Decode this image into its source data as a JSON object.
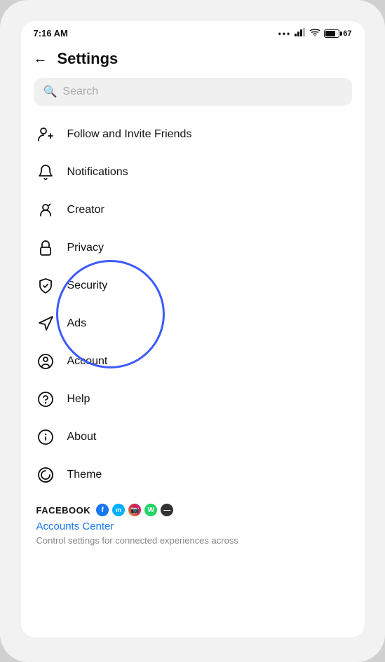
{
  "statusBar": {
    "time": "7:16 AM",
    "batteryLevel": "67"
  },
  "header": {
    "backLabel": "←",
    "title": "Settings"
  },
  "search": {
    "placeholder": "Search"
  },
  "menuItems": [
    {
      "id": "follow-invite",
      "label": "Follow and Invite Friends",
      "icon": "follow"
    },
    {
      "id": "notifications",
      "label": "Notifications",
      "icon": "bell"
    },
    {
      "id": "creator",
      "label": "Creator",
      "icon": "creator"
    },
    {
      "id": "privacy",
      "label": "Privacy",
      "icon": "lock"
    },
    {
      "id": "security",
      "label": "Security",
      "icon": "shield"
    },
    {
      "id": "ads",
      "label": "Ads",
      "icon": "ads"
    },
    {
      "id": "account",
      "label": "Account",
      "icon": "account"
    },
    {
      "id": "help",
      "label": "Help",
      "icon": "help"
    },
    {
      "id": "about",
      "label": "About",
      "icon": "info"
    },
    {
      "id": "theme",
      "label": "Theme",
      "icon": "theme"
    }
  ],
  "facebookSection": {
    "label": "FACEBOOK",
    "accountsCenterLink": "Accounts Center",
    "description": "Control settings for connected experiences across"
  }
}
